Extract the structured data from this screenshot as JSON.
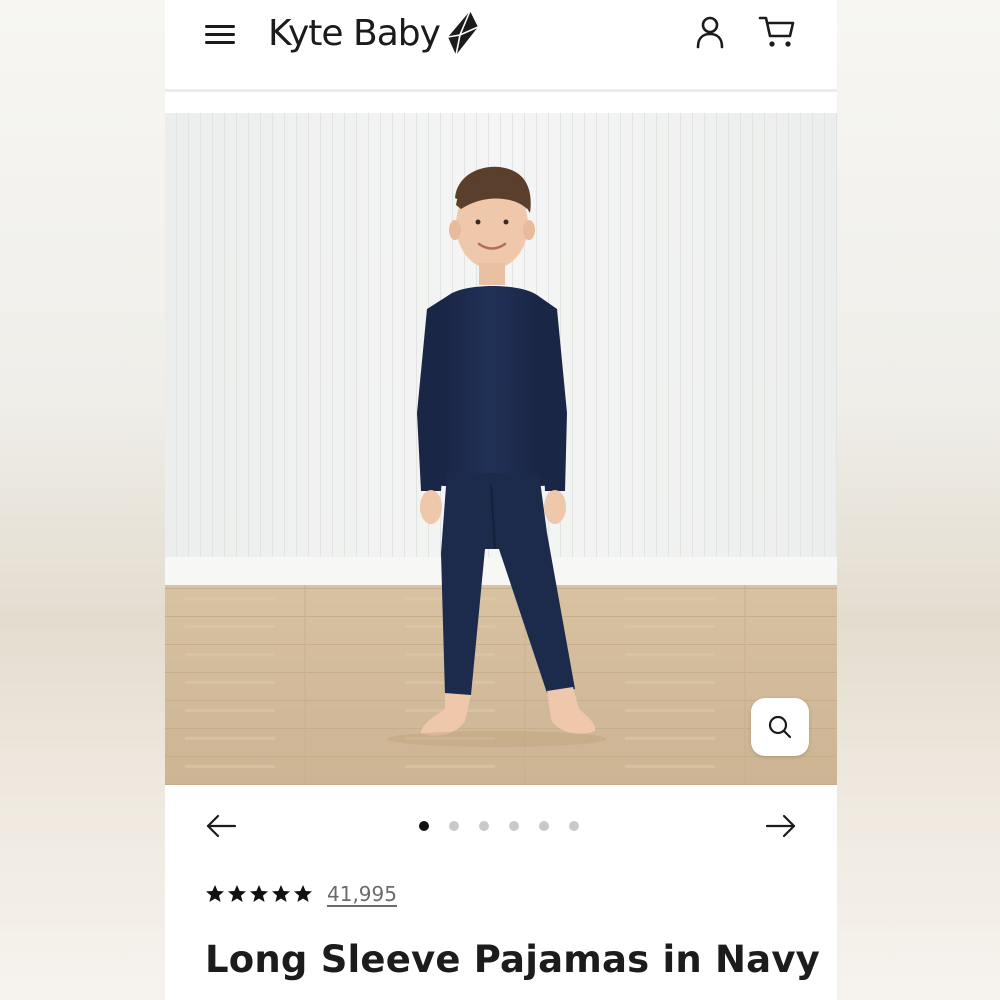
{
  "header": {
    "logo_text": "Kyte Baby",
    "icons": [
      "menu-icon",
      "kite-logo-icon",
      "account-icon",
      "cart-icon"
    ]
  },
  "hero": {
    "image_subject": "Child standing in navy long sleeve pajamas against white paneled wall on wood floor",
    "zoom_icon": "search-icon"
  },
  "carousel": {
    "slides": 6,
    "active_index": 0,
    "prev_icon": "arrow-left-icon",
    "next_icon": "arrow-right-icon"
  },
  "product": {
    "rating_stars": 5,
    "review_count": "41,995",
    "title": "Long Sleeve Pajamas in Navy"
  },
  "colors": {
    "text_dark": "#1b1b1b",
    "navy": "#1d2a4a",
    "dot_active": "#111111",
    "dot_inactive": "#c9c9c9"
  }
}
